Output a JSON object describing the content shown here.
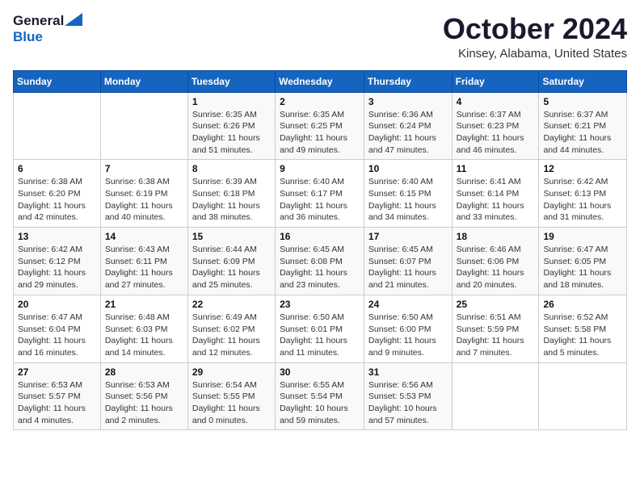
{
  "header": {
    "logo_general": "General",
    "logo_blue": "Blue",
    "month_title": "October 2024",
    "location": "Kinsey, Alabama, United States"
  },
  "days_of_week": [
    "Sunday",
    "Monday",
    "Tuesday",
    "Wednesday",
    "Thursday",
    "Friday",
    "Saturday"
  ],
  "weeks": [
    [
      {
        "num": "",
        "info": ""
      },
      {
        "num": "",
        "info": ""
      },
      {
        "num": "1",
        "info": "Sunrise: 6:35 AM\nSunset: 6:26 PM\nDaylight: 11 hours\nand 51 minutes."
      },
      {
        "num": "2",
        "info": "Sunrise: 6:35 AM\nSunset: 6:25 PM\nDaylight: 11 hours\nand 49 minutes."
      },
      {
        "num": "3",
        "info": "Sunrise: 6:36 AM\nSunset: 6:24 PM\nDaylight: 11 hours\nand 47 minutes."
      },
      {
        "num": "4",
        "info": "Sunrise: 6:37 AM\nSunset: 6:23 PM\nDaylight: 11 hours\nand 46 minutes."
      },
      {
        "num": "5",
        "info": "Sunrise: 6:37 AM\nSunset: 6:21 PM\nDaylight: 11 hours\nand 44 minutes."
      }
    ],
    [
      {
        "num": "6",
        "info": "Sunrise: 6:38 AM\nSunset: 6:20 PM\nDaylight: 11 hours\nand 42 minutes."
      },
      {
        "num": "7",
        "info": "Sunrise: 6:38 AM\nSunset: 6:19 PM\nDaylight: 11 hours\nand 40 minutes."
      },
      {
        "num": "8",
        "info": "Sunrise: 6:39 AM\nSunset: 6:18 PM\nDaylight: 11 hours\nand 38 minutes."
      },
      {
        "num": "9",
        "info": "Sunrise: 6:40 AM\nSunset: 6:17 PM\nDaylight: 11 hours\nand 36 minutes."
      },
      {
        "num": "10",
        "info": "Sunrise: 6:40 AM\nSunset: 6:15 PM\nDaylight: 11 hours\nand 34 minutes."
      },
      {
        "num": "11",
        "info": "Sunrise: 6:41 AM\nSunset: 6:14 PM\nDaylight: 11 hours\nand 33 minutes."
      },
      {
        "num": "12",
        "info": "Sunrise: 6:42 AM\nSunset: 6:13 PM\nDaylight: 11 hours\nand 31 minutes."
      }
    ],
    [
      {
        "num": "13",
        "info": "Sunrise: 6:42 AM\nSunset: 6:12 PM\nDaylight: 11 hours\nand 29 minutes."
      },
      {
        "num": "14",
        "info": "Sunrise: 6:43 AM\nSunset: 6:11 PM\nDaylight: 11 hours\nand 27 minutes."
      },
      {
        "num": "15",
        "info": "Sunrise: 6:44 AM\nSunset: 6:09 PM\nDaylight: 11 hours\nand 25 minutes."
      },
      {
        "num": "16",
        "info": "Sunrise: 6:45 AM\nSunset: 6:08 PM\nDaylight: 11 hours\nand 23 minutes."
      },
      {
        "num": "17",
        "info": "Sunrise: 6:45 AM\nSunset: 6:07 PM\nDaylight: 11 hours\nand 21 minutes."
      },
      {
        "num": "18",
        "info": "Sunrise: 6:46 AM\nSunset: 6:06 PM\nDaylight: 11 hours\nand 20 minutes."
      },
      {
        "num": "19",
        "info": "Sunrise: 6:47 AM\nSunset: 6:05 PM\nDaylight: 11 hours\nand 18 minutes."
      }
    ],
    [
      {
        "num": "20",
        "info": "Sunrise: 6:47 AM\nSunset: 6:04 PM\nDaylight: 11 hours\nand 16 minutes."
      },
      {
        "num": "21",
        "info": "Sunrise: 6:48 AM\nSunset: 6:03 PM\nDaylight: 11 hours\nand 14 minutes."
      },
      {
        "num": "22",
        "info": "Sunrise: 6:49 AM\nSunset: 6:02 PM\nDaylight: 11 hours\nand 12 minutes."
      },
      {
        "num": "23",
        "info": "Sunrise: 6:50 AM\nSunset: 6:01 PM\nDaylight: 11 hours\nand 11 minutes."
      },
      {
        "num": "24",
        "info": "Sunrise: 6:50 AM\nSunset: 6:00 PM\nDaylight: 11 hours\nand 9 minutes."
      },
      {
        "num": "25",
        "info": "Sunrise: 6:51 AM\nSunset: 5:59 PM\nDaylight: 11 hours\nand 7 minutes."
      },
      {
        "num": "26",
        "info": "Sunrise: 6:52 AM\nSunset: 5:58 PM\nDaylight: 11 hours\nand 5 minutes."
      }
    ],
    [
      {
        "num": "27",
        "info": "Sunrise: 6:53 AM\nSunset: 5:57 PM\nDaylight: 11 hours\nand 4 minutes."
      },
      {
        "num": "28",
        "info": "Sunrise: 6:53 AM\nSunset: 5:56 PM\nDaylight: 11 hours\nand 2 minutes."
      },
      {
        "num": "29",
        "info": "Sunrise: 6:54 AM\nSunset: 5:55 PM\nDaylight: 11 hours\nand 0 minutes."
      },
      {
        "num": "30",
        "info": "Sunrise: 6:55 AM\nSunset: 5:54 PM\nDaylight: 10 hours\nand 59 minutes."
      },
      {
        "num": "31",
        "info": "Sunrise: 6:56 AM\nSunset: 5:53 PM\nDaylight: 10 hours\nand 57 minutes."
      },
      {
        "num": "",
        "info": ""
      },
      {
        "num": "",
        "info": ""
      }
    ]
  ]
}
